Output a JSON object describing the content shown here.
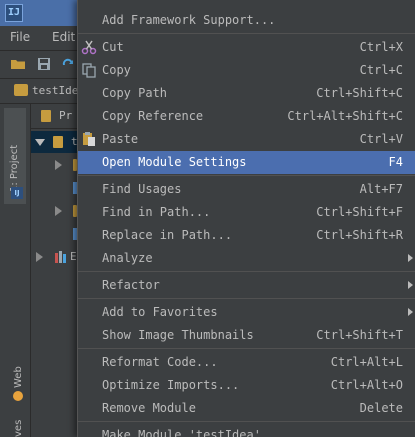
{
  "window": {
    "app_icon": "IJ"
  },
  "menubar": {
    "items": [
      "File",
      "Edit"
    ]
  },
  "navbar": {
    "project_label": "testIde"
  },
  "tool_window": {
    "header": "Pr",
    "tree_root": "t",
    "tree_lib": "E"
  },
  "side_tabs": {
    "project": "1: Project",
    "web": "Web",
    "bottom": "ves"
  },
  "context_menu": {
    "items": [
      {
        "label": "Add Framework Support...",
        "shortcut": ""
      },
      {
        "label": "Cut",
        "shortcut": "Ctrl+X",
        "icon": "scissors-icon"
      },
      {
        "label": "Copy",
        "shortcut": "Ctrl+C",
        "icon": "copy-icon"
      },
      {
        "label": "Copy Path",
        "shortcut": "Ctrl+Shift+C"
      },
      {
        "label": "Copy Reference",
        "shortcut": "Ctrl+Alt+Shift+C"
      },
      {
        "label": "Paste",
        "shortcut": "Ctrl+V",
        "icon": "paste-icon"
      },
      {
        "label": "Open Module Settings",
        "shortcut": "F4",
        "selected": true
      },
      {
        "label": "Find Usages",
        "shortcut": "Alt+F7"
      },
      {
        "label": "Find in Path...",
        "shortcut": "Ctrl+Shift+F"
      },
      {
        "label": "Replace in Path...",
        "shortcut": "Ctrl+Shift+R"
      },
      {
        "label": "Analyze",
        "shortcut": "",
        "submenu": true
      },
      {
        "label": "Refactor",
        "shortcut": "",
        "submenu": true
      },
      {
        "label": "Add to Favorites",
        "shortcut": "",
        "submenu": true
      },
      {
        "label": "Show Image Thumbnails",
        "shortcut": "Ctrl+Shift+T"
      },
      {
        "label": "Reformat Code...",
        "shortcut": "Ctrl+Alt+L"
      },
      {
        "label": "Optimize Imports...",
        "shortcut": "Ctrl+Alt+O"
      },
      {
        "label": "Remove Module",
        "shortcut": "Delete"
      },
      {
        "label": "Make Module 'testIdea'",
        "shortcut": ""
      }
    ]
  },
  "colors": {
    "menu_bg": "#3c3f41",
    "selection": "#4b6eaf",
    "title_bar": "#4a6fa8",
    "folder": "#c69c3f"
  }
}
